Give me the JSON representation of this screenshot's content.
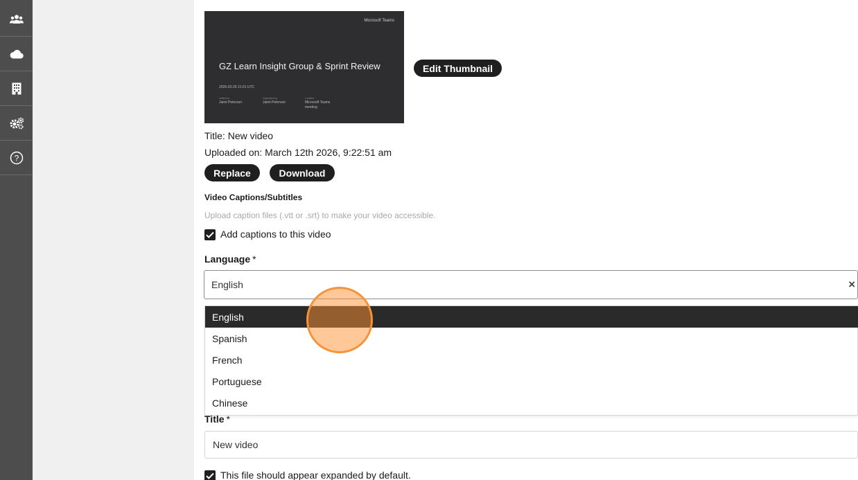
{
  "sidebar": {
    "items": [
      {
        "icon": "users-icon"
      },
      {
        "icon": "cloud-icon"
      },
      {
        "icon": "building-icon"
      },
      {
        "icon": "gears-icon"
      },
      {
        "icon": "help-icon"
      }
    ]
  },
  "thumbnail": {
    "brand": "Microsoft Teams",
    "heading": "GZ Learn Insight Group & Sprint Review",
    "date": "2026-02-25 21:01 UTC",
    "meta": [
      {
        "label": "Invited by",
        "value": "Jaimi Peterson"
      },
      {
        "label": "Organized by",
        "value": "Jaimi Peterson"
      },
      {
        "label": "Location",
        "value": "Microsoft Teams meeting"
      }
    ],
    "edit_label": "Edit Thumbnail"
  },
  "video": {
    "title_line": "Title: New video",
    "uploaded_line": "Uploaded on: March 12th 2026, 9:22:51 am",
    "replace_label": "Replace",
    "download_label": "Download"
  },
  "captions": {
    "heading": "Video Captions/Subtitles",
    "hint": "Upload caption files (.vtt or .srt) to make your video accessible.",
    "add_label": "Add captions to this video",
    "add_checked": true,
    "language_label": "Language",
    "required_mark": "*",
    "language_value": "English",
    "clear_glyph": "×",
    "options": [
      "English",
      "Spanish",
      "French",
      "Portuguese",
      "Chinese"
    ],
    "selected_option": "English",
    "title_label": "Title",
    "title_value": "New video",
    "expanded_label": "This file should appear expanded by default.",
    "expanded_checked": true
  },
  "colors": {
    "sidebar": "#4d4d4d",
    "gutter": "#f0f0f0",
    "button": "#1f1f1f",
    "selected_option": "#2a2a2a",
    "cursor_highlight": "#f5933a"
  }
}
